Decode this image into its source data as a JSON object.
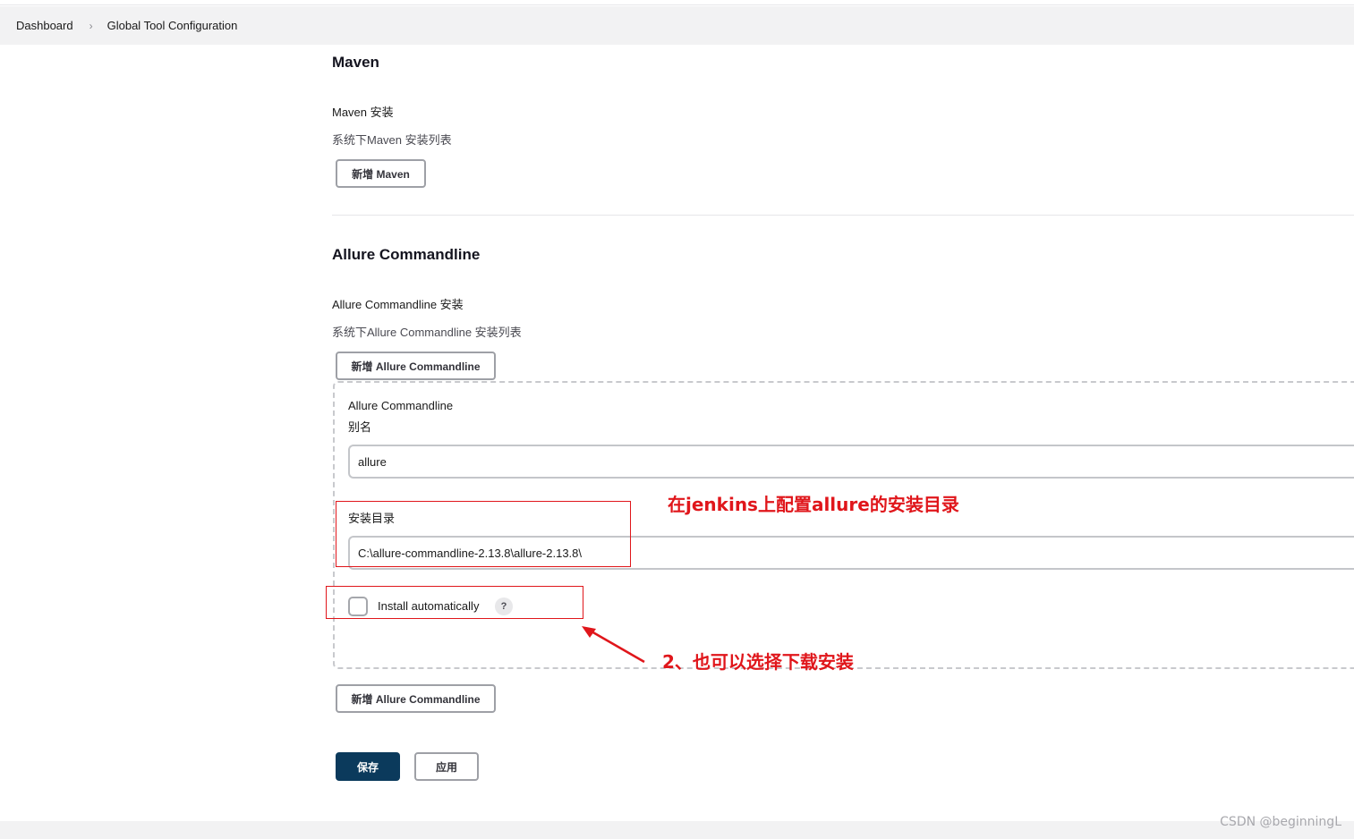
{
  "breadcrumb": {
    "items": [
      "Dashboard",
      "Global Tool Configuration"
    ],
    "separator": "›"
  },
  "maven": {
    "title": "Maven",
    "install_label": "Maven 安装",
    "install_desc": "系统下Maven 安装列表",
    "add_button": "新增 Maven"
  },
  "allure": {
    "title": "Allure Commandline",
    "install_label": "Allure Commandline 安装",
    "install_desc": "系统下Allure Commandline 安装列表",
    "add_button_top": "新增 Allure Commandline",
    "add_button_bottom": "新增 Allure Commandline",
    "entry": {
      "header": "Allure Commandline",
      "alias_label": "别名",
      "alias_value": "allure",
      "home_label": "安装目录",
      "home_value": "C:\\allure-commandline-2.13.8\\allure-2.13.8\\",
      "install_auto_label": "Install automatically",
      "install_auto_checked": false,
      "help_glyph": "?"
    }
  },
  "actions": {
    "save": "保存",
    "apply": "应用"
  },
  "annotations": {
    "note1": "在jenkins上配置allure的安装目录",
    "note2": "2、也可以选择下载安装",
    "color": "#e0161b"
  },
  "watermark": "CSDN @beginningL",
  "colors": {
    "save_button": "#0b3a5c",
    "breadcrumb_bg": "#f2f2f3"
  }
}
